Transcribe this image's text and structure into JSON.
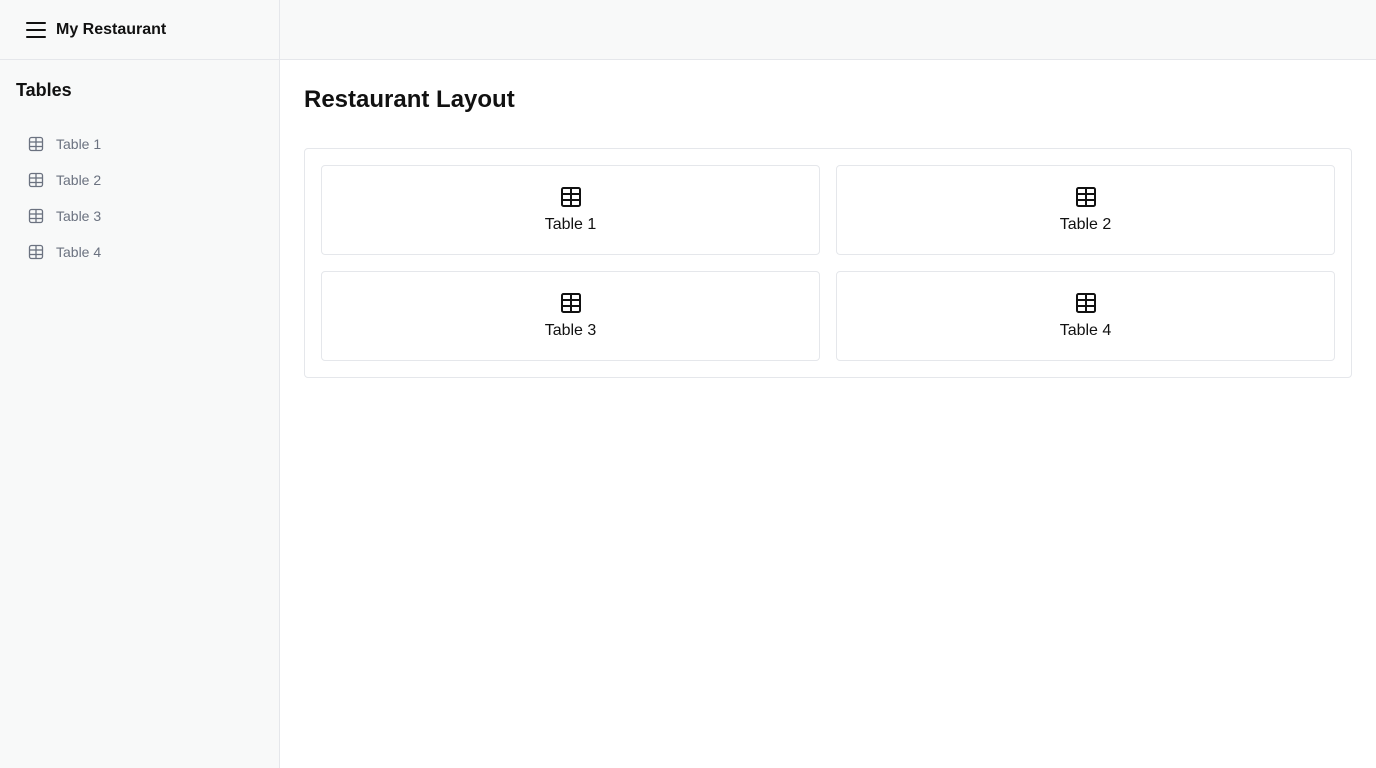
{
  "app": {
    "title": "My Restaurant"
  },
  "sidebar": {
    "section_title": "Tables",
    "items": [
      {
        "label": "Table 1",
        "icon": "table-icon"
      },
      {
        "label": "Table 2",
        "icon": "table-icon"
      },
      {
        "label": "Table 3",
        "icon": "table-icon"
      },
      {
        "label": "Table 4",
        "icon": "table-icon"
      }
    ]
  },
  "main": {
    "title": "Restaurant Layout",
    "tables": [
      {
        "label": "Table 1",
        "icon": "table-icon"
      },
      {
        "label": "Table 2",
        "icon": "table-icon"
      },
      {
        "label": "Table 3",
        "icon": "table-icon"
      },
      {
        "label": "Table 4",
        "icon": "table-icon"
      }
    ]
  },
  "colors": {
    "sidebar_bg": "#f8f9f9",
    "border": "#e5e7eb",
    "muted_text": "#6b7280",
    "text": "#111111"
  }
}
